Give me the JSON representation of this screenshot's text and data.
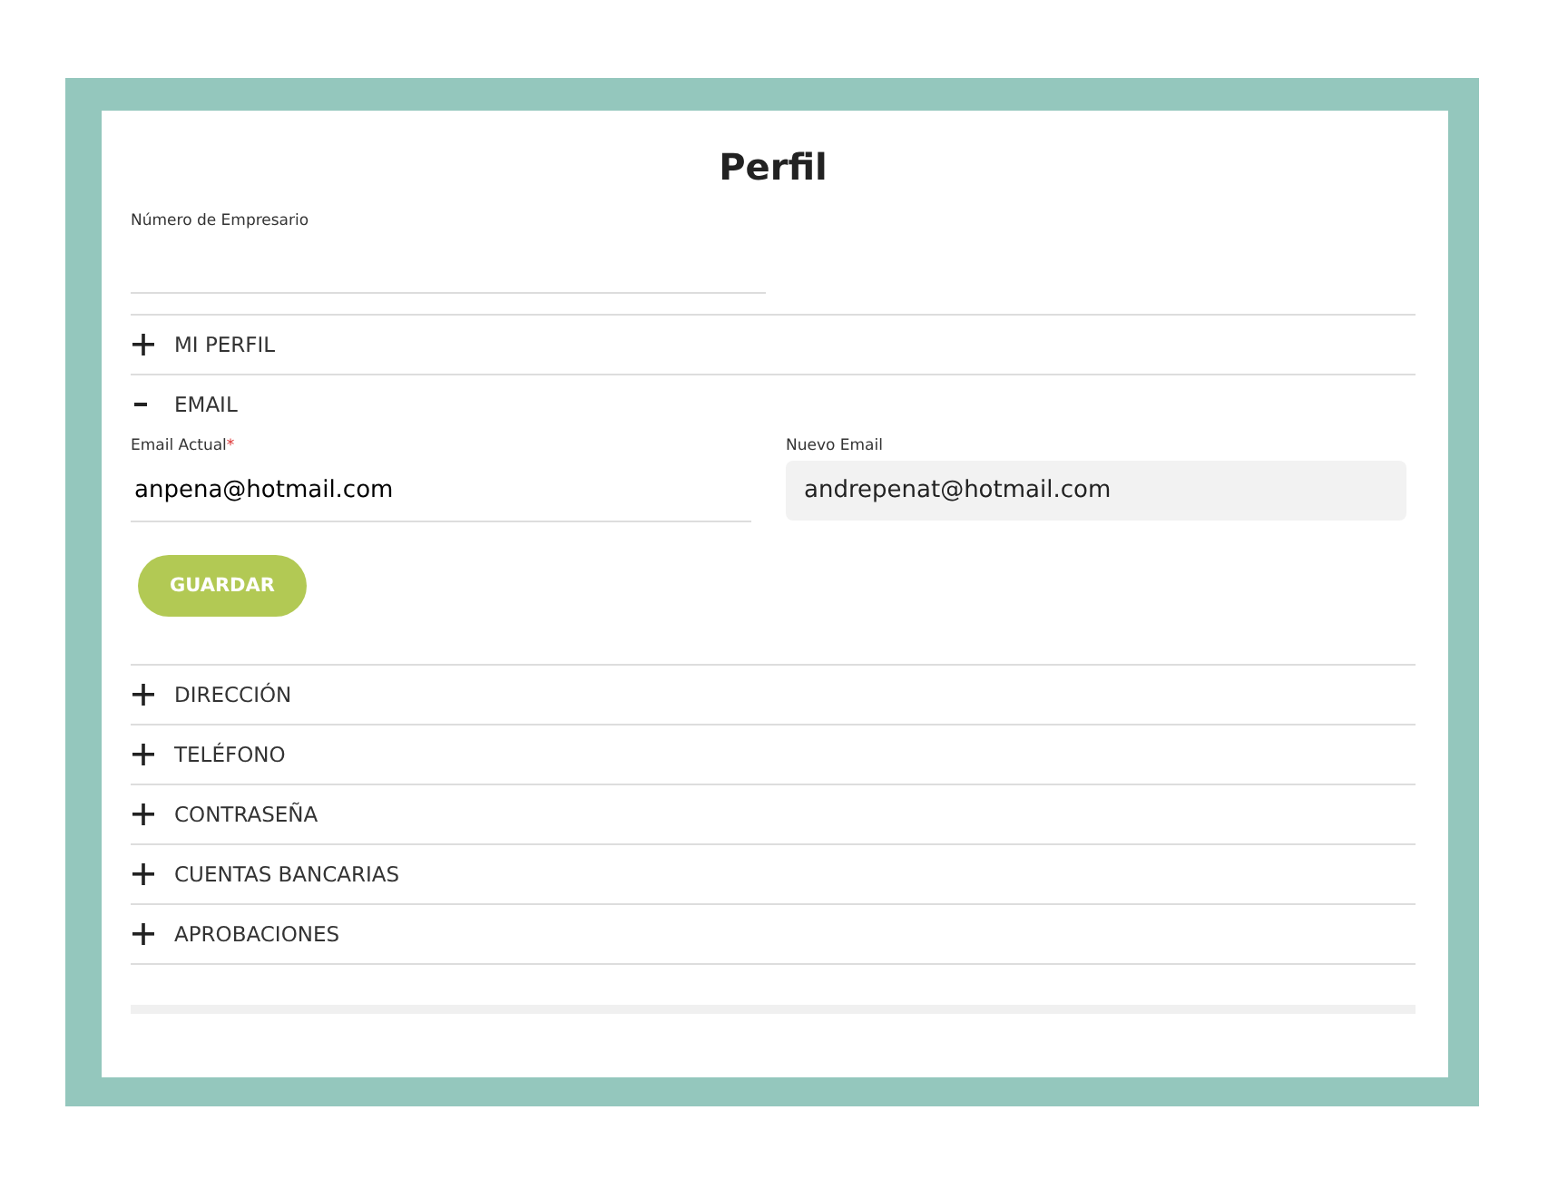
{
  "title": "Perfil",
  "employer_field": {
    "label": "Número de Empresario"
  },
  "sections": [
    {
      "label": "MI PERFIL",
      "expanded": false
    },
    {
      "label": "EMAIL",
      "expanded": true,
      "fields": [
        {
          "label": "Email Actual",
          "required_mark": "*",
          "value": "anpena@hotmail.com",
          "kind": "underline"
        },
        {
          "label": "Nuevo Email",
          "value": "andrepenat@hotmail.com",
          "kind": "filled"
        }
      ],
      "button": "GUARDAR"
    },
    {
      "label": "DIRECCIÓN",
      "expanded": false
    },
    {
      "label": "TELÉFONO",
      "expanded": false
    },
    {
      "label": "CONTRASEÑA",
      "expanded": false
    },
    {
      "label": "CUENTAS BANCARIAS",
      "expanded": false
    },
    {
      "label": "APROBACIONES",
      "expanded": false
    }
  ]
}
